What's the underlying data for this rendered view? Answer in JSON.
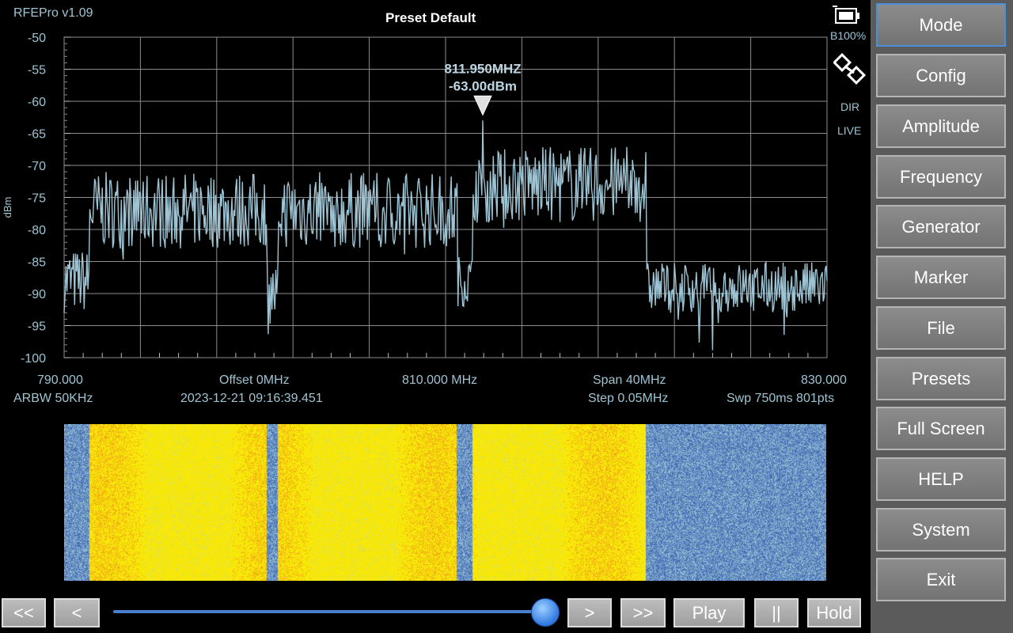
{
  "app": {
    "version": "RFEPro v1.09",
    "preset": "Preset Default"
  },
  "status": {
    "battery": "B100%",
    "dir": "DIR",
    "live": "LIVE",
    "battery_icon": "battery-icon",
    "link_icon": "usb-link-icon"
  },
  "marker": {
    "freq": "811.950MHZ",
    "level": "-63.00dBm",
    "freq_value": 811.95,
    "level_value": -63.0
  },
  "axis": {
    "ylabel": "dBm",
    "yticks": [
      "-50",
      "-55",
      "-60",
      "-65",
      "-70",
      "-75",
      "-80",
      "-85",
      "-90",
      "-95",
      "-100"
    ]
  },
  "freq_info": {
    "start": "790.000",
    "offset": "Offset 0MHz",
    "center": "810.000 MHz",
    "span": "Span 40MHz",
    "stop": "830.000",
    "rbw": "ARBW 50KHz",
    "timestamp": "2023-12-21 09:16:39.451",
    "step": "Step 0.05MHz",
    "sweep": "Swp 750ms  801pts"
  },
  "menu": [
    "Mode",
    "Config",
    "Amplitude",
    "Frequency",
    "Generator",
    "Marker",
    "File",
    "Presets",
    "Full Screen",
    "HELP",
    "System",
    "Exit"
  ],
  "playback": {
    "first": "<<",
    "prev": "<",
    "next": ">",
    "last": ">>",
    "play": "Play",
    "pause": "||",
    "hold": "Hold",
    "position": 0.99
  },
  "colors": {
    "trace": "#9ec4d4",
    "grid": "#8c8c8c",
    "sidebar": "#5b5b5b",
    "accent": "#4a8fd8",
    "waterfall_hot": "#f5e800",
    "waterfall_cold": "#5a84c0"
  },
  "chart_data": {
    "type": "line",
    "xlim": [
      790,
      830
    ],
    "ylim": [
      -100,
      -50
    ],
    "ylabel": "dBm",
    "grid": true,
    "series": [
      {
        "segments": [
          {
            "x": [
              790.0,
              791.3
            ],
            "level": -88,
            "spread": 5
          },
          {
            "x": [
              791.3,
              800.6
            ],
            "level": -77,
            "spread": 6
          },
          {
            "x": [
              800.6,
              801.2
            ],
            "level": -90,
            "spread": 5
          },
          {
            "x": [
              801.2,
              810.6
            ],
            "level": -77,
            "spread": 6
          },
          {
            "x": [
              810.6,
              811.4
            ],
            "level": -88,
            "spread": 4
          },
          {
            "x": [
              811.4,
              820.5
            ],
            "level": -73,
            "spread": 6
          },
          {
            "x": [
              820.5,
              830.0
            ],
            "level": -89,
            "spread": 4
          }
        ],
        "peak": {
          "x": 811.95,
          "y": -63.0
        }
      }
    ]
  }
}
